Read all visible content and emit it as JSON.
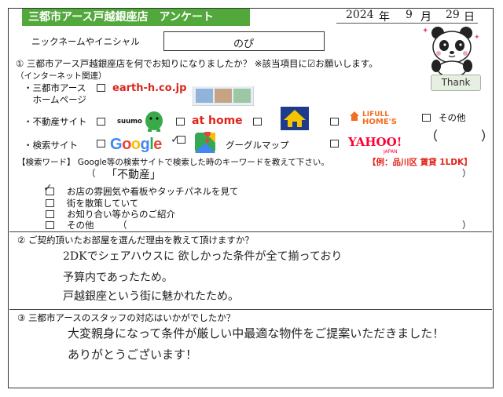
{
  "header": {
    "title": "三都市アース戸越銀座店　アンケート",
    "date": {
      "year": "2024",
      "year_unit": "年",
      "month": "9",
      "month_unit": "月",
      "day": "29",
      "day_unit": "日"
    }
  },
  "nickname": {
    "label": "ニックネームやイニシャル",
    "value": "のぴ"
  },
  "q1": {
    "question": "① 三都市アース戸越銀座店を何でお知りになりましたか？ ※該当項目に☑お願いします。",
    "internet_label": "（インターネット関連）",
    "homepage_label_1": "・三都市アース",
    "homepage_label_2": "　ホームページ",
    "homepage_logo": "earth-h.co.jp",
    "realestate_label": "・不動産サイト",
    "suumo_logo": "suumo",
    "athome_logo": "at home",
    "lifull_logo_1": "LIFULL",
    "lifull_logo_2": "HOME'S",
    "other_label": "その他",
    "paren_open": "（",
    "paren_close": "）",
    "search_label": "・検索サイト",
    "google_logo": "Google",
    "googlemap_label": "グーグルマップ",
    "yahoo_logo": "YAHOO!",
    "yahoo_sub": "JAPAN",
    "keyword_label": "【検索ワード】 Google等の検索サイトで検索した時のキーワードを教えて下さい。",
    "keyword_example": "【例：品川区 賃貸 1LDK】",
    "keyword_value": "「不動産」",
    "offline_options": [
      "お店の雰囲気や看板やタッチパネルを見て",
      "街を散策していて",
      "お知り合い等からのご紹介",
      "その他"
    ]
  },
  "q2": {
    "question": "② ご契約頂いたお部屋を選んだ理由を教えて頂けますか？",
    "answer_lines": [
      "2DKでシェアハウスに 欲しかった条件が全て揃っており",
      "予算内であったため。",
      "戸越銀座という街に魅かれたため。"
    ]
  },
  "q3": {
    "question": "③ 三都市アースのスタッフの対応はいかがでしたか？",
    "answer_lines": [
      "大変親身になって条件が厳しい中最適な物件をご提案いただきました！",
      "ありがとうございます！"
    ]
  },
  "mascot": {
    "thank_label": "Thank"
  },
  "colors": {
    "title_bg": "#52a83b",
    "earth_red": "#d8271c",
    "athome_red": "#e2231a",
    "lifull_orange": "#f26d21",
    "yahoo_red": "#ff0033"
  }
}
